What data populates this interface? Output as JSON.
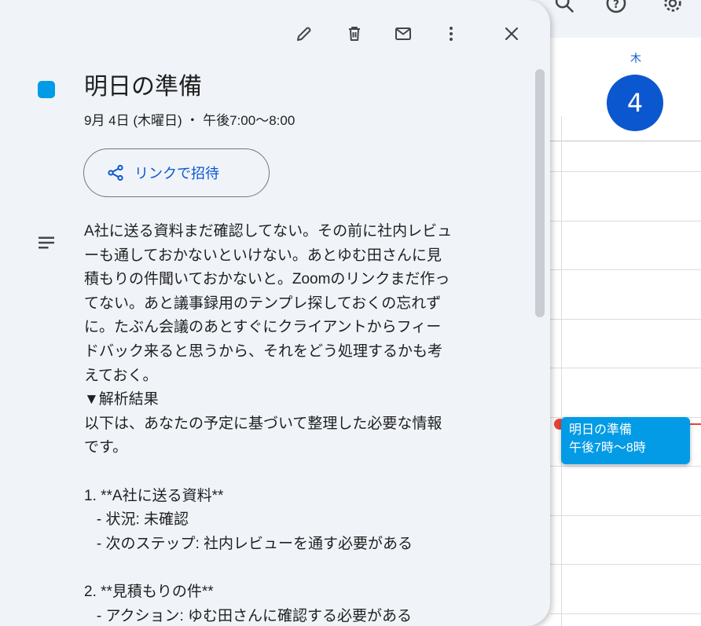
{
  "calendar": {
    "day_name": "木",
    "day_number": "4",
    "event_chip": {
      "title": "明日の準備",
      "time": "午後7時〜8時"
    }
  },
  "toolbar": {
    "icons": [
      "search-icon",
      "help-icon",
      "gear-icon"
    ]
  },
  "dialog": {
    "actions": [
      "edit-icon",
      "delete-icon",
      "email-icon",
      "more-vert-icon",
      "close-icon"
    ],
    "event": {
      "color": "#039be5",
      "title": "明日の準備",
      "datetime": "9月 4日 (木曜日) ・ 午後7:00〜8:00"
    },
    "invite_button_label": "リンクで招待",
    "description": "A社に送る資料まだ確認してない。その前に社内レビュ\nーも通しておかないといけない。あとゆむ田さんに見\n積もりの件聞いておかないと。Zoomのリンクまだ作っ\nてない。あと議事録用のテンプレ探しておくの忘れず\nに。たぶん会議のあとすぐにクライアントからフィー\nドバック来ると思うから、それをどう処理するかも考\nえておく。\n▼解析結果\n以下は、あなたの予定に基づいて整理した必要な情報\nです。\n\n1. **A社に送る資料**\n   - 状況: 未確認\n   - 次のステップ: 社内レビューを通す必要がある\n\n2. **見積もりの件**\n   - アクション: ゆむ田さんに確認する必要がある"
  },
  "colors": {
    "accent": "#0b57d0",
    "event": "#039be5",
    "now_line": "#ea4335",
    "dialog_bg": "#f0f4f9"
  }
}
